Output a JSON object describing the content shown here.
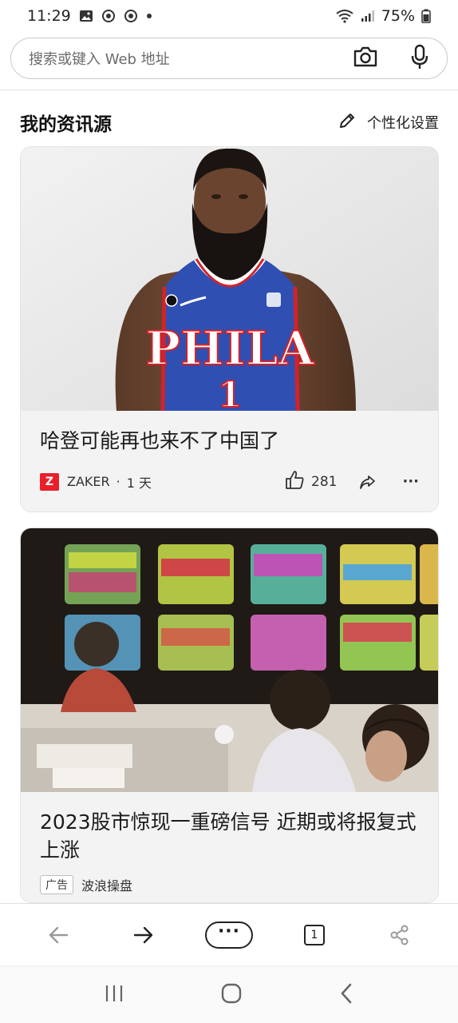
{
  "status_bar": {
    "time": "11:29",
    "battery": "75%"
  },
  "search": {
    "placeholder": "搜索或键入 Web 地址"
  },
  "feed": {
    "title": "我的资讯源",
    "personalize_label": "个性化设置"
  },
  "articles": [
    {
      "title": "哈登可能再也来不了中国了",
      "source_logo_letter": "Z",
      "source": "ZAKER",
      "separator": "·",
      "age": "1 天",
      "likes": "281",
      "more": "···"
    },
    {
      "title": "2023股市惊现一重磅信号 近期或将报复式上涨",
      "ad_label": "广告",
      "source": "波浪操盘"
    }
  ],
  "jersey": {
    "team": "PHILA",
    "number": "1"
  },
  "toolbar": {
    "menu_label": "···",
    "tab_count": "1"
  },
  "colors": {
    "zaker_red": "#e8202a",
    "jersey_blue": "#2f4fb3",
    "jersey_red": "#d2232a"
  }
}
